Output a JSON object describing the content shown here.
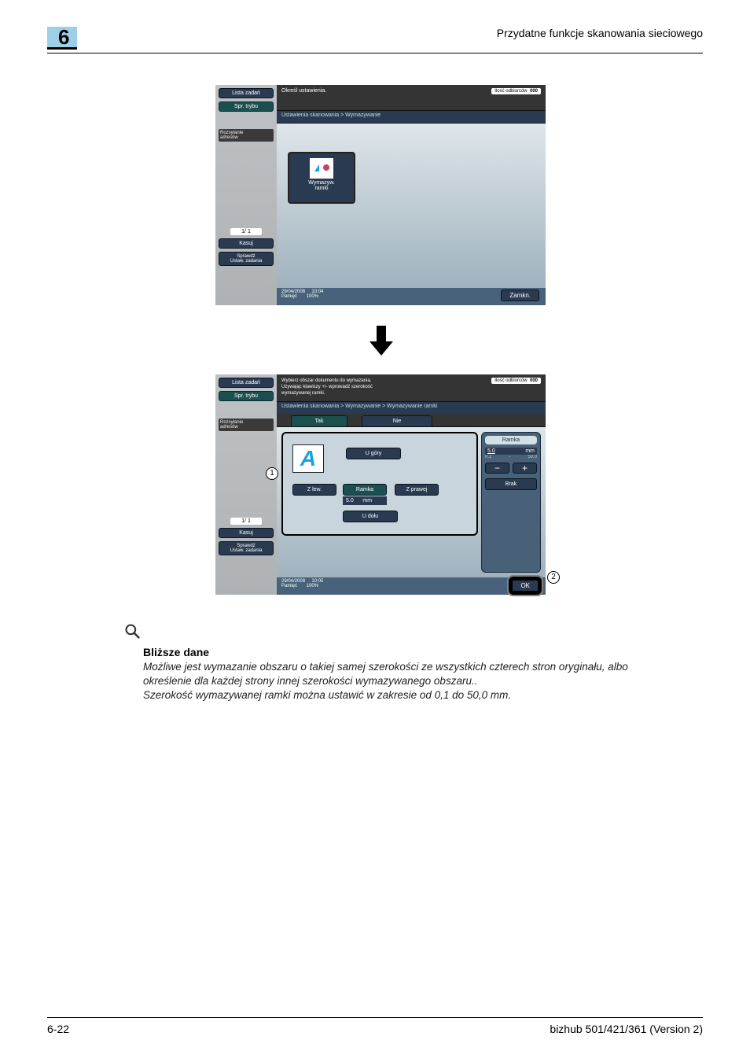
{
  "chapter_number": "6",
  "page_header_title": "Przydatne funkcje skanowania sieciowego",
  "footer_left": "6-22",
  "footer_right": "bizhub 501/421/361 (Version 2)",
  "sidebar": {
    "list": "Lista zadań",
    "mode": "Spr. trybu",
    "broadcast": "Rozsyłanie\nadresów",
    "page": "1/  1",
    "delete": "Kasuj",
    "check": "Sprawdź\nUstaw. zadania"
  },
  "panel1": {
    "top_msg": "Określ ustawienia.",
    "badge_label": "Ilość odbiorców",
    "badge_value": "000",
    "breadcrumb": "Ustawienia skanowania > Wymazywanie",
    "tile_label": "Wymazyw.\nramki",
    "status_date": "29/04/2008",
    "status_time": "10:04",
    "status_mem": "Pamięć",
    "status_pct": "100%",
    "close": "Zamkn."
  },
  "panel2": {
    "top_msg": "Wybierz obszar dokumentu do wymazania.\nUżywając klawiszy +/- wprowadź szerokość\nwymazywanej ramki.",
    "badge_label": "Ilość odbiorców",
    "badge_value": "000",
    "breadcrumb": "Ustawienia skanowania > Wymazywanie > Wymazywanie ramki",
    "tab_yes": "Tak",
    "tab_no": "Nie",
    "a_letter": "A",
    "pos_top": "U góry",
    "pos_left": "Z lew.",
    "pos_center": "Ramka",
    "center_value": "5.0",
    "center_unit": "mm",
    "pos_right": "Z prawej",
    "pos_bottom": "U dołu",
    "right_header": "Ramka",
    "value": "5.0",
    "unit": "mm",
    "range_min": "0.1",
    "range_sep": "-",
    "range_max": "50.0",
    "minus": "−",
    "plus": "+",
    "none": "Brak",
    "ok": "OK",
    "status_date": "29/04/2008",
    "status_time": "10:05",
    "status_mem": "Pamięć",
    "status_pct": "100%"
  },
  "callout_1": "1",
  "callout_2": "2",
  "detail": {
    "heading": "Bliższe dane",
    "body": "Możliwe jest wymazanie obszaru o takiej samej szerokości ze wszystkich czterech stron oryginału, albo określenie dla każdej strony innej szerokości wymazywanego obszaru..\nSzerokość wymazywanej ramki można ustawić w zakresie od 0,1 do 50,0 mm."
  }
}
